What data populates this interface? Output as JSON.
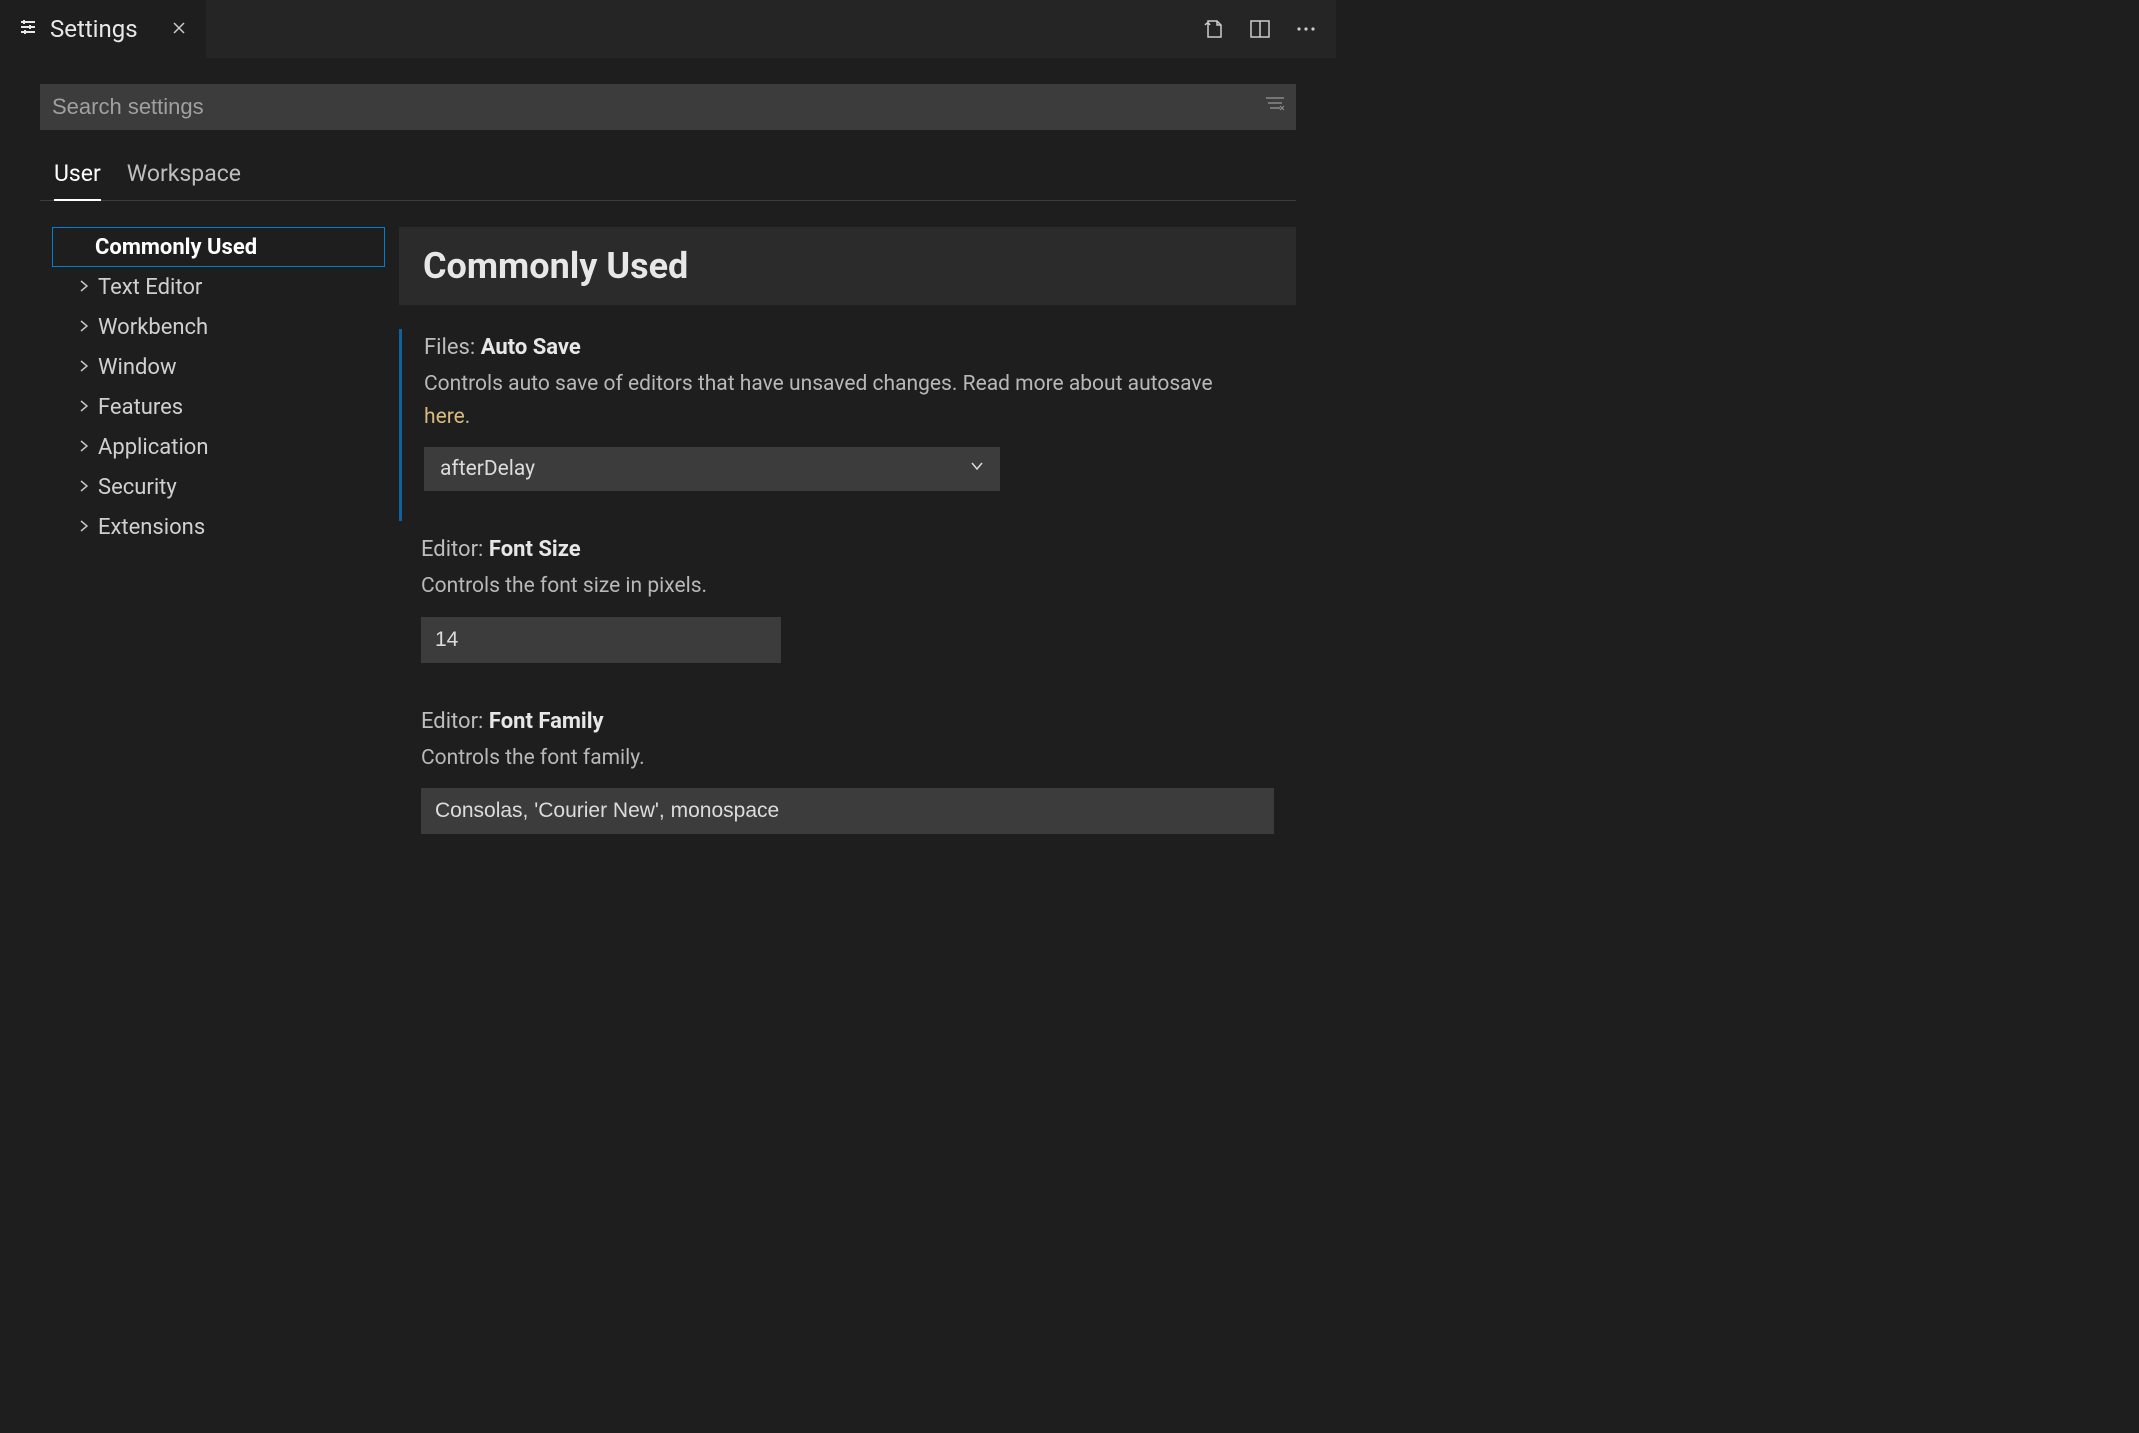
{
  "tab": {
    "title": "Settings"
  },
  "search": {
    "placeholder": "Search settings"
  },
  "scopeTabs": {
    "user": "User",
    "workspace": "Workspace"
  },
  "toc": {
    "active": "Commonly Used",
    "items": [
      "Text Editor",
      "Workbench",
      "Window",
      "Features",
      "Application",
      "Security",
      "Extensions"
    ]
  },
  "section": {
    "title": "Commonly Used"
  },
  "settings": {
    "autoSave": {
      "cat": "Files:",
      "name": "Auto Save",
      "desc1": "Controls auto save of editors that have unsaved changes. Read more about autosave ",
      "link": "here",
      "desc2": ".",
      "value": "afterDelay"
    },
    "fontSize": {
      "cat": "Editor:",
      "name": "Font Size",
      "desc": "Controls the font size in pixels.",
      "value": "14"
    },
    "fontFamily": {
      "cat": "Editor:",
      "name": "Font Family",
      "desc": "Controls the font family.",
      "value": "Consolas, 'Courier New', monospace"
    }
  }
}
